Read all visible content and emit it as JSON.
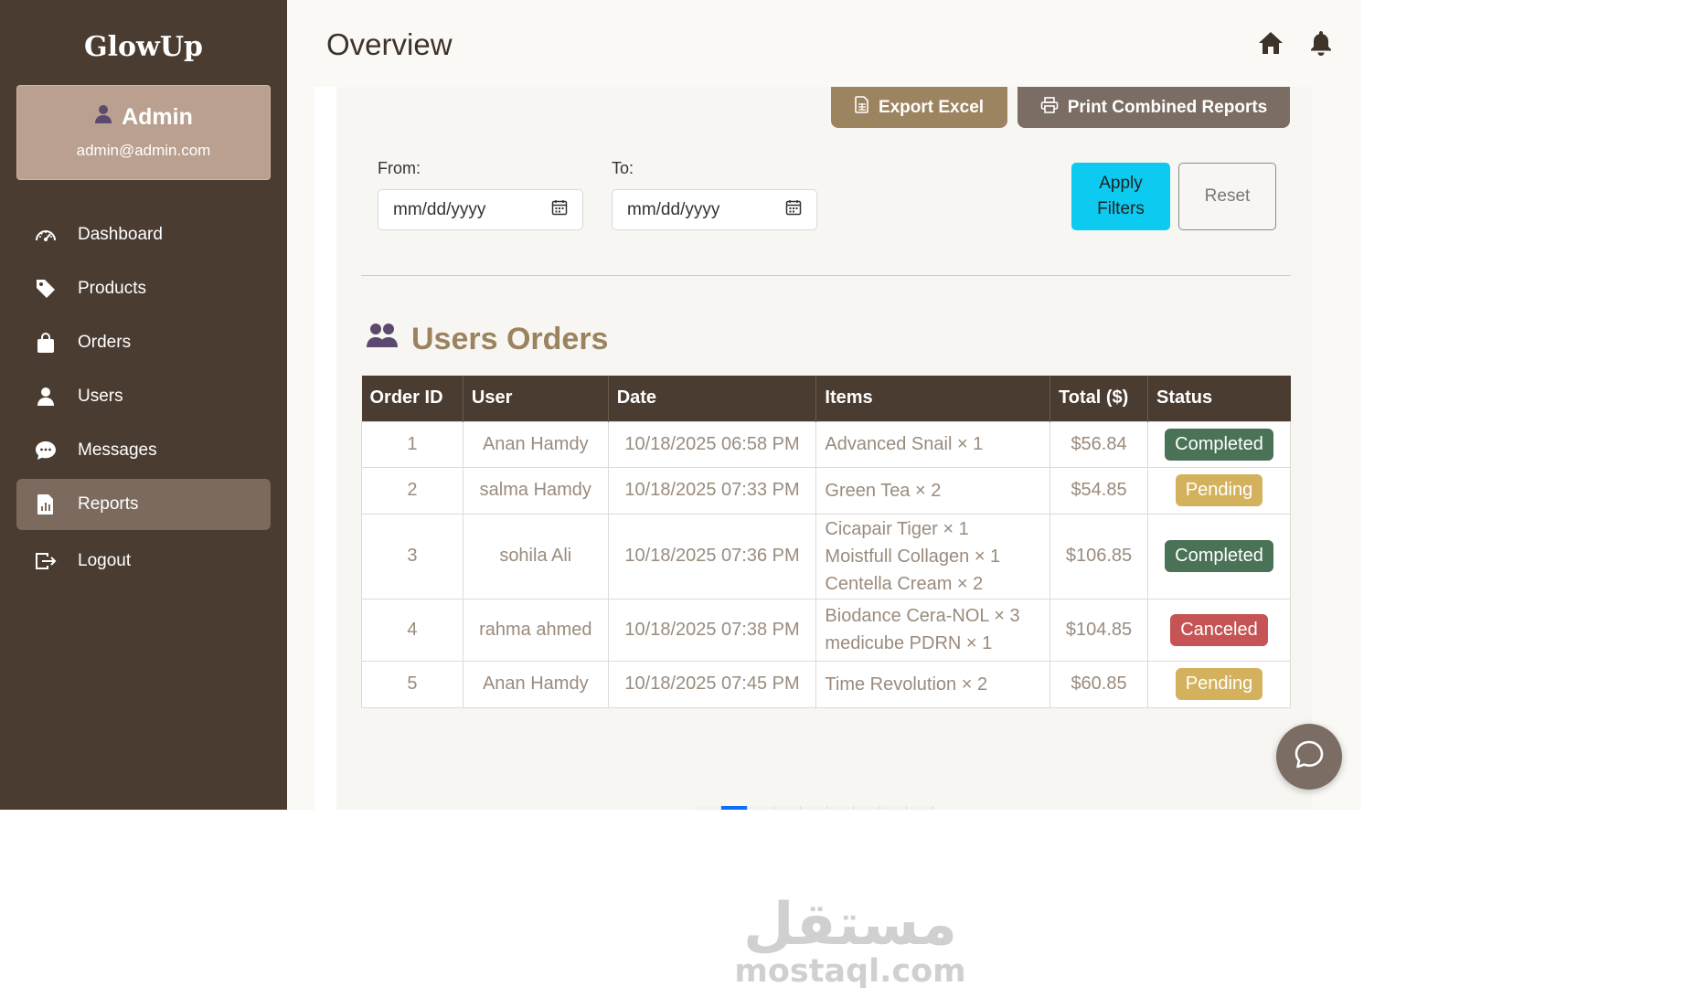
{
  "sidebar": {
    "brand": "GlowUp",
    "profile": {
      "name": "Admin",
      "email": "admin@admin.com"
    },
    "items": [
      {
        "label": "Dashboard",
        "icon": "gauge-icon"
      },
      {
        "label": "Products",
        "icon": "tag-icon"
      },
      {
        "label": "Orders",
        "icon": "shopping-bag-icon"
      },
      {
        "label": "Users",
        "icon": "user-icon"
      },
      {
        "label": "Messages",
        "icon": "chat-bubble-icon"
      },
      {
        "label": "Reports",
        "icon": "report-file-icon",
        "active": true
      },
      {
        "label": "Logout",
        "icon": "logout-icon"
      }
    ]
  },
  "header": {
    "title": "Overview",
    "icons": [
      "home-icon",
      "bell-icon"
    ]
  },
  "toolbar": {
    "export_label": "Export Excel",
    "print_label": "Print Combined Reports"
  },
  "filters": {
    "from_label": "From:",
    "to_label": "To:",
    "from_placeholder": "mm/dd/yyyy",
    "to_placeholder": "mm/dd/yyyy",
    "apply_label_1": "Apply",
    "apply_label_2": "Filters",
    "reset_label": "Reset"
  },
  "orders": {
    "title": "Users Orders",
    "columns": [
      "Order ID",
      "User",
      "Date",
      "Items",
      "Total ($)",
      "Status"
    ],
    "rows": [
      {
        "id": "1",
        "user": "Anan Hamdy",
        "date": "10/18/2025 06:58 PM",
        "items": [
          "Advanced Snail × 1"
        ],
        "total": "$56.84",
        "status": "Completed"
      },
      {
        "id": "2",
        "user": "salma Hamdy",
        "date": "10/18/2025 07:33 PM",
        "items": [
          "Green Tea × 2"
        ],
        "total": "$54.85",
        "status": "Pending"
      },
      {
        "id": "3",
        "user": "sohila Ali",
        "date": "10/18/2025 07:36 PM",
        "items": [
          "Cicapair Tiger × 1",
          "Moistfull Collagen × 1",
          "Centella Cream × 2"
        ],
        "total": "$106.85",
        "status": "Completed"
      },
      {
        "id": "4",
        "user": "rahma ahmed",
        "date": "10/18/2025 07:38 PM",
        "items": [
          "Biodance Cera-NOL × 3",
          "medicube PDRN × 1"
        ],
        "total": "$104.85",
        "status": "Canceled"
      },
      {
        "id": "5",
        "user": "Anan Hamdy",
        "date": "10/18/2025 07:45 PM",
        "items": [
          "Time Revolution × 2"
        ],
        "total": "$60.85",
        "status": "Pending"
      }
    ]
  },
  "status_colors": {
    "Completed": "#4a7256",
    "Pending": "#d4b25d",
    "Canceled": "#c65454"
  },
  "watermark": {
    "arabic": "مستقل",
    "latin": "mostaql.com"
  }
}
